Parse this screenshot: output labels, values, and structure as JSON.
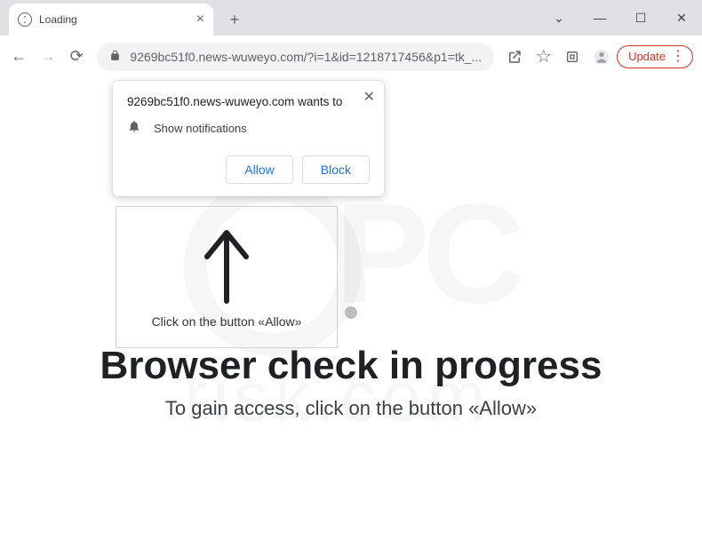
{
  "tab": {
    "title": "Loading",
    "close_glyph": "×"
  },
  "window_controls": {
    "caret": "⌄",
    "minimize": "—",
    "maximize": "☐",
    "close": "✕"
  },
  "toolbar": {
    "back": "←",
    "forward": "→",
    "reload": "⟳",
    "url": "9269bc51f0.news-wuweyo.com/?i=1&id=1218717456&p1=tk_...",
    "lock_glyph": "🔒",
    "share_glyph": "↗",
    "star_glyph": "☆",
    "ext_glyph": "▣",
    "profile_glyph": "👤",
    "update_label": "Update",
    "menu_glyph": "⋮"
  },
  "permission": {
    "origin_line": "9269bc51f0.news-wuweyo.com wants to",
    "request_label": "Show notifications",
    "bell_glyph": "🔔",
    "allow_label": "Allow",
    "block_label": "Block",
    "close_glyph": "✕"
  },
  "page": {
    "arrow_caption": "Click on the button «Allow»",
    "headline": "Browser check in progress",
    "subline": "To gain access, click on the button «Allow»"
  },
  "watermark": {
    "brand_main": "PC",
    "brand_sub": "risk.com"
  }
}
